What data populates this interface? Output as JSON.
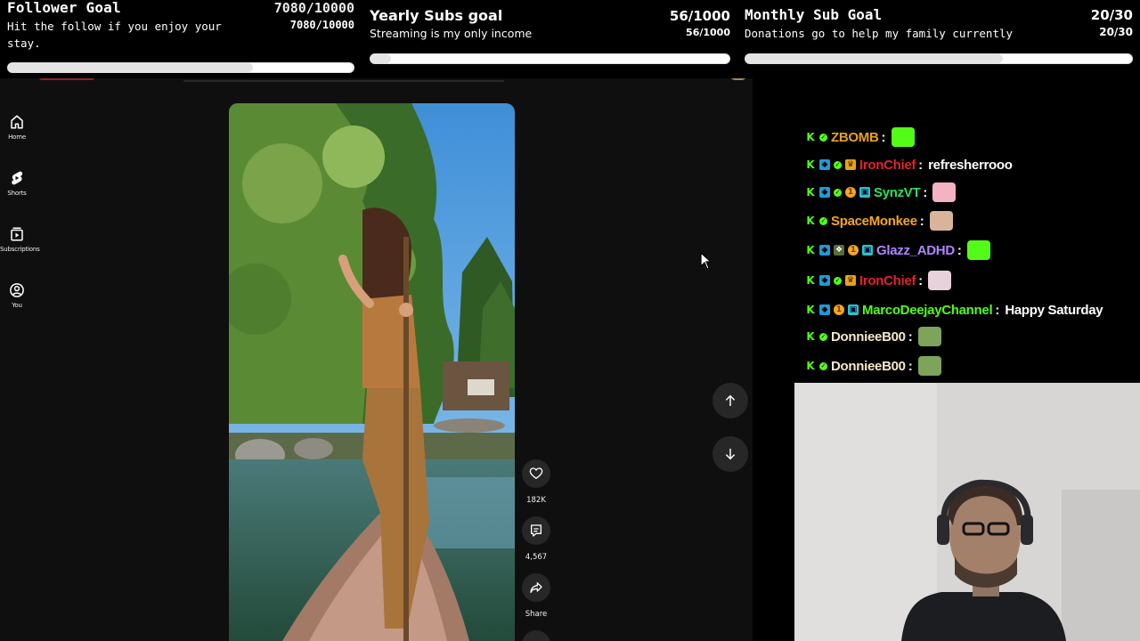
{
  "goals": {
    "follower": {
      "title": "Follower Goal",
      "count": "7080/10000",
      "description": "Hit the follow if you enjoy your stay.",
      "count_small": "7080/10000",
      "progress": 0.708
    },
    "yearly": {
      "title": "Yearly Subs goal",
      "count": "56/1000",
      "description": "Streaming is my only income",
      "count_small": "56/1000",
      "progress": 0.056
    },
    "monthly": {
      "title": "Monthly Sub Goal",
      "count": "20/30",
      "description": "Donations go to help my family currently",
      "count_small": "20/30",
      "progress": 0.667
    }
  },
  "youtube": {
    "nav": [
      {
        "label": "Home",
        "icon": "home-icon"
      },
      {
        "label": "Shorts",
        "icon": "shorts-icon"
      },
      {
        "label": "Subscriptions",
        "icon": "subscriptions-icon"
      },
      {
        "label": "You",
        "icon": "you-icon"
      }
    ],
    "actions": {
      "likes": "182K",
      "comments": "4,567",
      "share": "Share"
    }
  },
  "chat": {
    "colors": {
      "kick_green": "#53fc18"
    },
    "messages": [
      {
        "user": "ZBOMB",
        "color": "#e8a317",
        "text": "",
        "emote": "kick-emote",
        "badges": [
          "k",
          "ver"
        ]
      },
      {
        "user": "IronChief",
        "color": "#e0242c",
        "text": "refresherrooo",
        "emote": "",
        "badges": [
          "k",
          "mod",
          "ver",
          "crown"
        ]
      },
      {
        "user": "SynzVT",
        "color": "#2ee05a",
        "text": "",
        "emote": "pink-creature-emote",
        "badges": [
          "k",
          "mod",
          "ver",
          "coin",
          "gift"
        ]
      },
      {
        "user": "SpaceMonkee",
        "color": "#f5a623",
        "text": "",
        "emote": "fist-emote",
        "badges": [
          "k",
          "ver"
        ]
      },
      {
        "user": "Glazz_ADHD",
        "color": "#b283ff",
        "text": "",
        "emote": "kick-logo-emote",
        "badges": [
          "k",
          "mod",
          "bug",
          "coin",
          "gift"
        ]
      },
      {
        "user": "IronChief",
        "color": "#e0242c",
        "text": "",
        "emote": "heart-creature-emote",
        "badges": [
          "k",
          "mod",
          "ver",
          "crown"
        ]
      },
      {
        "user": "MarcoDeejayChannel",
        "color": "#53fc18",
        "text": "Happy Saturday",
        "emote": "",
        "badges": [
          "k",
          "mod",
          "coin",
          "gift"
        ]
      },
      {
        "user": "DonnieeB00",
        "color": "#f5e9c9",
        "text": "",
        "emote": "goblin-emote",
        "badges": [
          "k",
          "ver"
        ]
      },
      {
        "user": "DonnieeB00",
        "color": "#f5e9c9",
        "text": "",
        "emote": "goblin-emote",
        "badges": [
          "k",
          "ver"
        ]
      }
    ]
  }
}
